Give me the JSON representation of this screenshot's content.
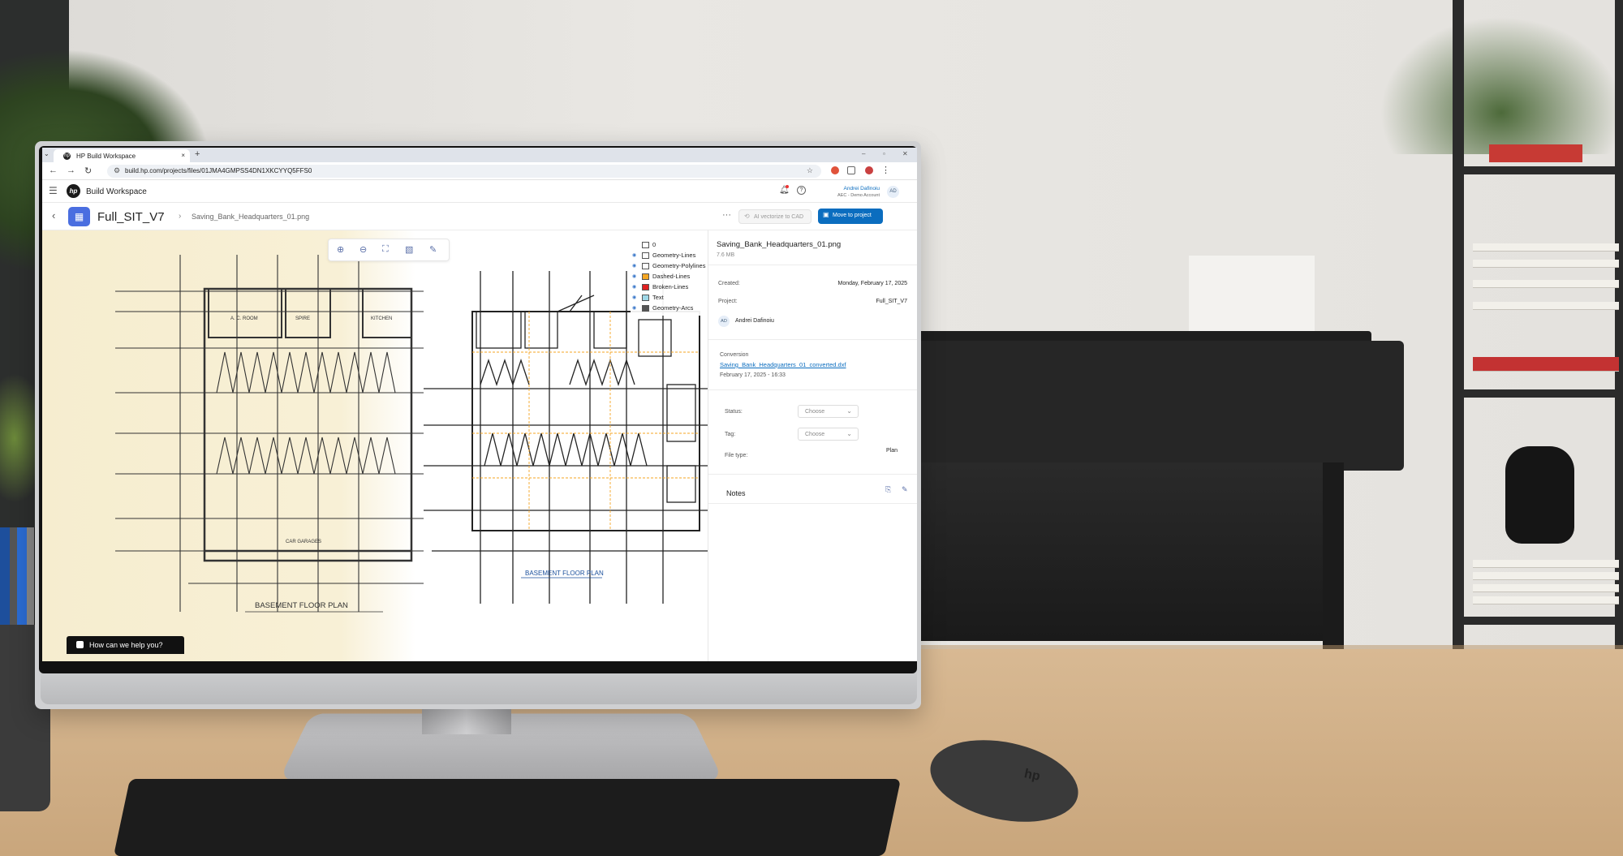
{
  "browser": {
    "tab_title": "HP Build Workspace",
    "tab_logo": "hp",
    "new_tab": "+",
    "close_tab": "×",
    "url": "build.hp.com/projects/files/01JMA4GMPSS4DN1XKCYYQ5FFS0"
  },
  "app": {
    "logo": "hp",
    "title": "Build Workspace",
    "user_name": "Andrei Dafinoiu",
    "user_account": "AEC - Demo Account",
    "user_initials": "AD"
  },
  "header": {
    "project_name": "Full_SIT_V7",
    "file_name": "Saving_Bank_Headquarters_01.png",
    "ai_vectorize_label": "AI vectorize to CAD",
    "move_label": "Move to project",
    "accent_color": "#0b6dbf"
  },
  "canvas": {
    "scan_title": "BASEMENT  FLOOR PLAN",
    "vector_title": "BASEMENT  FLOOR PLAN",
    "room_labels": [
      "A. C. ROOM",
      "SPIRE",
      "KITCHEN",
      "CAR  GARAGES"
    ],
    "tools": [
      "zoom-in-icon",
      "zoom-out-icon",
      "fit-icon",
      "image-icon",
      "edit-icon"
    ],
    "help_label": "How can we help you?",
    "layers": [
      {
        "name": "0",
        "color": "#ffffff",
        "visible": false
      },
      {
        "name": "Geometry-Lines",
        "color": "#ffffff",
        "visible": true
      },
      {
        "name": "Geometry-Polylines",
        "color": "#ffffff",
        "visible": true
      },
      {
        "name": "Dashed-Lines",
        "color": "#f5a623",
        "visible": true
      },
      {
        "name": "Broken-Lines",
        "color": "#e02020",
        "visible": true
      },
      {
        "name": "Text",
        "color": "#9fd8e8",
        "visible": true
      },
      {
        "name": "Geometry-Arcs",
        "color": "#555555",
        "visible": true
      }
    ]
  },
  "details": {
    "file_name": "Saving_Bank_Headquarters_01.png",
    "file_size": "7.6 MB",
    "created_label": "Created:",
    "created_value": "Monday, February 17, 2025",
    "project_label": "Project:",
    "project_value": "Full_SIT_V7",
    "owner_initials": "AD",
    "owner_name": "Andrei Dafinoiu",
    "conversion_label": "Conversion",
    "conversion_file": "Saving_Bank_Headquarters_01_converted.dxf",
    "conversion_date": "February 17, 2025 - 16:33",
    "status_label": "Status:",
    "status_value": "Choose",
    "tag_label": "Tag:",
    "tag_value": "Choose",
    "filetype_label": "File type:",
    "filetype_value": "Plan",
    "notes_label": "Notes"
  },
  "monitor": {
    "brand": "hp"
  }
}
